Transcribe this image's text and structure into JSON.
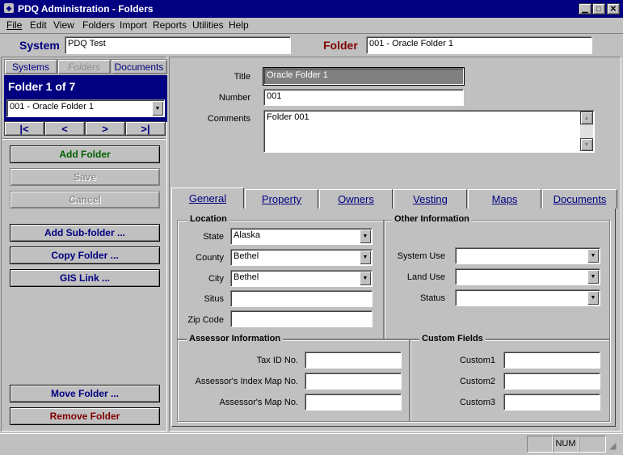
{
  "window": {
    "title": "PDQ Administration - Folders"
  },
  "menu": [
    "File",
    "Edit",
    "View",
    "Folders",
    "Import",
    "Reports",
    "Utilities",
    "Help"
  ],
  "header": {
    "system_label": "System",
    "system_value": "PDQ Test",
    "folder_label": "Folder",
    "folder_value": "001 - Oracle Folder 1"
  },
  "nav": {
    "tabs": [
      "Systems",
      "Folders",
      "Documents"
    ],
    "position": "Folder 1 of 7",
    "selected": "001 - Oracle Folder 1",
    "buttons": [
      "|<",
      "<",
      ">",
      ">|"
    ]
  },
  "actions": {
    "add": "Add Folder",
    "save": "Save",
    "cancel": "Cancel",
    "add_sub": "Add Sub-folder ...",
    "copy": "Copy Folder ...",
    "gis": "GIS Link ...",
    "move": "Move Folder ...",
    "remove": "Remove Folder"
  },
  "detail": {
    "title_label": "Title",
    "title_value": "Oracle Folder 1",
    "number_label": "Number",
    "number_value": "001",
    "comments_label": "Comments",
    "comments_value": "Folder 001"
  },
  "tabs": [
    "General",
    "Property",
    "Owners",
    "Vesting",
    "Maps",
    "Documents"
  ],
  "location": {
    "title": "Location",
    "state_label": "State",
    "state": "Alaska",
    "county_label": "County",
    "county": "Bethel",
    "city_label": "City",
    "city": "Bethel",
    "situs_label": "Situs",
    "situs": "",
    "zip_label": "Zip Code",
    "zip": ""
  },
  "other": {
    "title": "Other Information",
    "system_use_label": "System Use",
    "land_use_label": "Land Use",
    "status_label": "Status"
  },
  "assessor": {
    "title": "Assessor Information",
    "tax_label": "Tax ID No.",
    "index_label": "Assessor's Index Map No.",
    "map_label": "Assessor's Map No."
  },
  "custom": {
    "title": "Custom Fields",
    "c1": "Custom1",
    "c2": "Custom2",
    "c3": "Custom3"
  },
  "status": {
    "num": "NUM"
  },
  "colors": {
    "titlebar": "#000080",
    "accent_green": "#006000",
    "accent_red": "#800000",
    "folder_label": "#800000"
  }
}
